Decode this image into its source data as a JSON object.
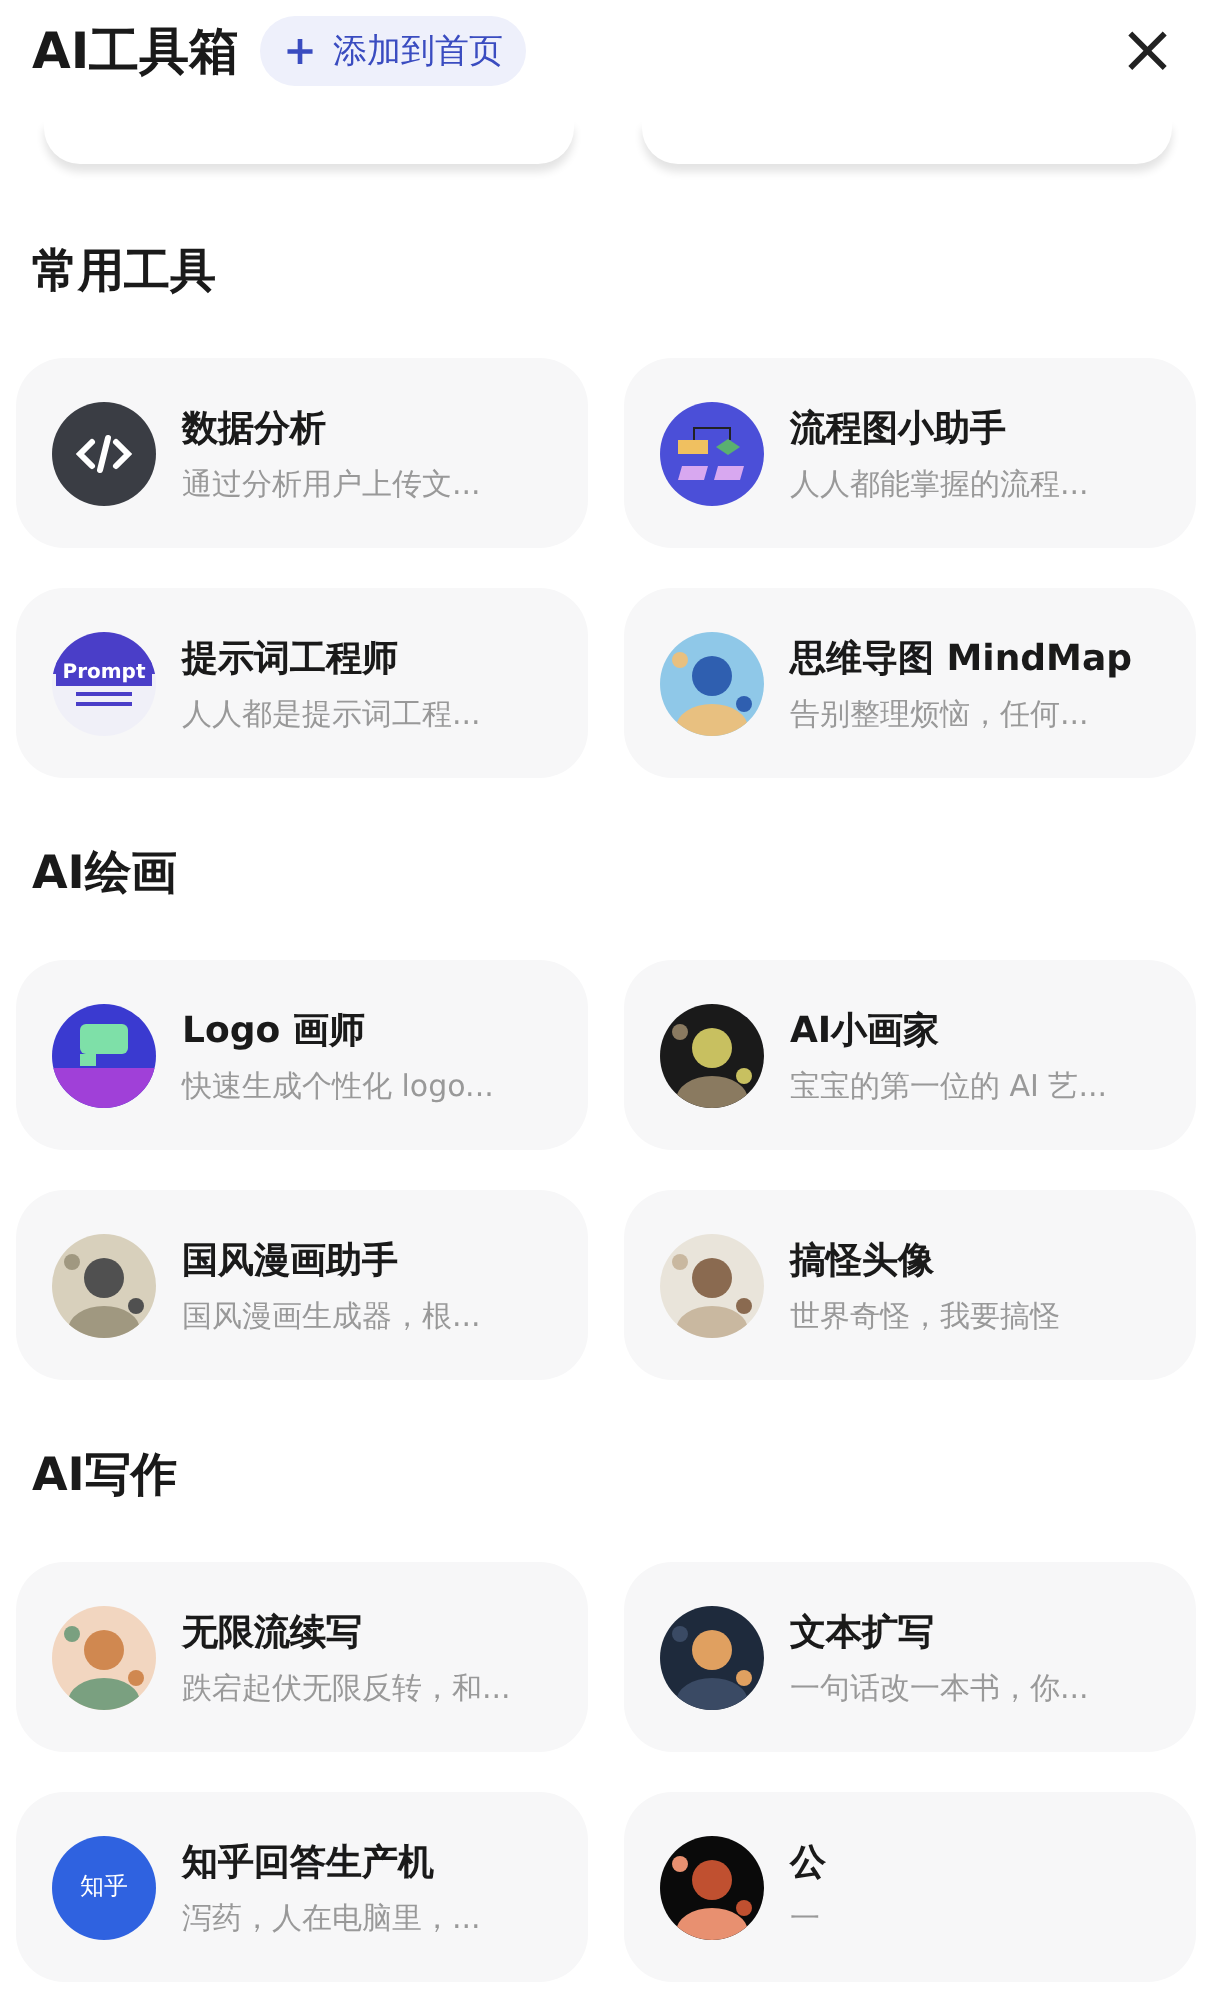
{
  "header": {
    "title": "AI工具箱",
    "add_button": {
      "icon": "+",
      "label": "添加到首页"
    },
    "close": "×"
  },
  "sections": [
    {
      "title": "常用工具",
      "tools": [
        {
          "name": "数据分析",
          "desc": "通过分析用户上传文...",
          "kind": "code"
        },
        {
          "name": "流程图小助手",
          "desc": "人人都能掌握的流程...",
          "kind": "flowchart"
        },
        {
          "name": "提示词工程师",
          "desc": "人人都是提示词工程...",
          "kind": "prompt",
          "icon_text": "Prompt"
        },
        {
          "name": "思维导图 MindMap",
          "desc": "告别整理烦恼，任何...",
          "kind": "picture"
        }
      ]
    },
    {
      "title": "AI绘画",
      "tools": [
        {
          "name": "Logo 画师",
          "desc": "快速生成个性化 logo...",
          "kind": "logo"
        },
        {
          "name": "AI小画家",
          "desc": "宝宝的第一位的 AI 艺...",
          "kind": "picture"
        },
        {
          "name": "国风漫画助手",
          "desc": "国风漫画生成器，根...",
          "kind": "picture"
        },
        {
          "name": "搞怪头像",
          "desc": "世界奇怪，我要搞怪",
          "kind": "picture"
        }
      ]
    },
    {
      "title": "AI写作",
      "tools": [
        {
          "name": "无限流续写",
          "desc": "跌宕起伏无限反转，和...",
          "kind": "picture"
        },
        {
          "name": "文本扩写",
          "desc": "一句话改一本书，你...",
          "kind": "picture"
        },
        {
          "name": "知乎回答生产机",
          "desc": "泻药，人在电脑里，...",
          "kind": "brand",
          "icon_text": "知乎"
        },
        {
          "name": "公",
          "desc": "一",
          "kind": "picture"
        }
      ]
    }
  ]
}
